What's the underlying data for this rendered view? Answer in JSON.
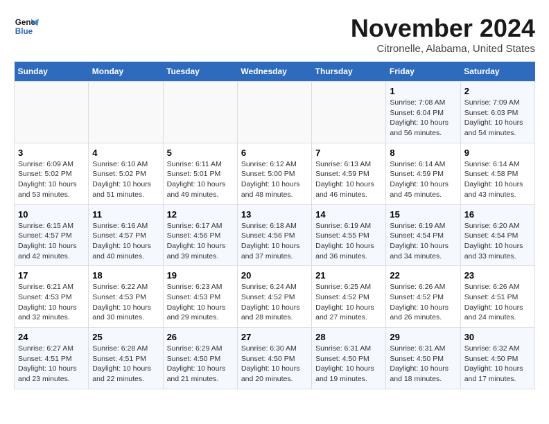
{
  "header": {
    "logo_line1": "General",
    "logo_line2": "Blue",
    "title": "November 2024",
    "subtitle": "Citronelle, Alabama, United States"
  },
  "weekdays": [
    "Sunday",
    "Monday",
    "Tuesday",
    "Wednesday",
    "Thursday",
    "Friday",
    "Saturday"
  ],
  "weeks": [
    [
      {
        "day": "",
        "info": ""
      },
      {
        "day": "",
        "info": ""
      },
      {
        "day": "",
        "info": ""
      },
      {
        "day": "",
        "info": ""
      },
      {
        "day": "",
        "info": ""
      },
      {
        "day": "1",
        "info": "Sunrise: 7:08 AM\nSunset: 6:04 PM\nDaylight: 10 hours and 56 minutes."
      },
      {
        "day": "2",
        "info": "Sunrise: 7:09 AM\nSunset: 6:03 PM\nDaylight: 10 hours and 54 minutes."
      }
    ],
    [
      {
        "day": "3",
        "info": "Sunrise: 6:09 AM\nSunset: 5:02 PM\nDaylight: 10 hours and 53 minutes."
      },
      {
        "day": "4",
        "info": "Sunrise: 6:10 AM\nSunset: 5:02 PM\nDaylight: 10 hours and 51 minutes."
      },
      {
        "day": "5",
        "info": "Sunrise: 6:11 AM\nSunset: 5:01 PM\nDaylight: 10 hours and 49 minutes."
      },
      {
        "day": "6",
        "info": "Sunrise: 6:12 AM\nSunset: 5:00 PM\nDaylight: 10 hours and 48 minutes."
      },
      {
        "day": "7",
        "info": "Sunrise: 6:13 AM\nSunset: 4:59 PM\nDaylight: 10 hours and 46 minutes."
      },
      {
        "day": "8",
        "info": "Sunrise: 6:14 AM\nSunset: 4:59 PM\nDaylight: 10 hours and 45 minutes."
      },
      {
        "day": "9",
        "info": "Sunrise: 6:14 AM\nSunset: 4:58 PM\nDaylight: 10 hours and 43 minutes."
      }
    ],
    [
      {
        "day": "10",
        "info": "Sunrise: 6:15 AM\nSunset: 4:57 PM\nDaylight: 10 hours and 42 minutes."
      },
      {
        "day": "11",
        "info": "Sunrise: 6:16 AM\nSunset: 4:57 PM\nDaylight: 10 hours and 40 minutes."
      },
      {
        "day": "12",
        "info": "Sunrise: 6:17 AM\nSunset: 4:56 PM\nDaylight: 10 hours and 39 minutes."
      },
      {
        "day": "13",
        "info": "Sunrise: 6:18 AM\nSunset: 4:56 PM\nDaylight: 10 hours and 37 minutes."
      },
      {
        "day": "14",
        "info": "Sunrise: 6:19 AM\nSunset: 4:55 PM\nDaylight: 10 hours and 36 minutes."
      },
      {
        "day": "15",
        "info": "Sunrise: 6:19 AM\nSunset: 4:54 PM\nDaylight: 10 hours and 34 minutes."
      },
      {
        "day": "16",
        "info": "Sunrise: 6:20 AM\nSunset: 4:54 PM\nDaylight: 10 hours and 33 minutes."
      }
    ],
    [
      {
        "day": "17",
        "info": "Sunrise: 6:21 AM\nSunset: 4:53 PM\nDaylight: 10 hours and 32 minutes."
      },
      {
        "day": "18",
        "info": "Sunrise: 6:22 AM\nSunset: 4:53 PM\nDaylight: 10 hours and 30 minutes."
      },
      {
        "day": "19",
        "info": "Sunrise: 6:23 AM\nSunset: 4:53 PM\nDaylight: 10 hours and 29 minutes."
      },
      {
        "day": "20",
        "info": "Sunrise: 6:24 AM\nSunset: 4:52 PM\nDaylight: 10 hours and 28 minutes."
      },
      {
        "day": "21",
        "info": "Sunrise: 6:25 AM\nSunset: 4:52 PM\nDaylight: 10 hours and 27 minutes."
      },
      {
        "day": "22",
        "info": "Sunrise: 6:26 AM\nSunset: 4:52 PM\nDaylight: 10 hours and 26 minutes."
      },
      {
        "day": "23",
        "info": "Sunrise: 6:26 AM\nSunset: 4:51 PM\nDaylight: 10 hours and 24 minutes."
      }
    ],
    [
      {
        "day": "24",
        "info": "Sunrise: 6:27 AM\nSunset: 4:51 PM\nDaylight: 10 hours and 23 minutes."
      },
      {
        "day": "25",
        "info": "Sunrise: 6:28 AM\nSunset: 4:51 PM\nDaylight: 10 hours and 22 minutes."
      },
      {
        "day": "26",
        "info": "Sunrise: 6:29 AM\nSunset: 4:50 PM\nDaylight: 10 hours and 21 minutes."
      },
      {
        "day": "27",
        "info": "Sunrise: 6:30 AM\nSunset: 4:50 PM\nDaylight: 10 hours and 20 minutes."
      },
      {
        "day": "28",
        "info": "Sunrise: 6:31 AM\nSunset: 4:50 PM\nDaylight: 10 hours and 19 minutes."
      },
      {
        "day": "29",
        "info": "Sunrise: 6:31 AM\nSunset: 4:50 PM\nDaylight: 10 hours and 18 minutes."
      },
      {
        "day": "30",
        "info": "Sunrise: 6:32 AM\nSunset: 4:50 PM\nDaylight: 10 hours and 17 minutes."
      }
    ]
  ]
}
